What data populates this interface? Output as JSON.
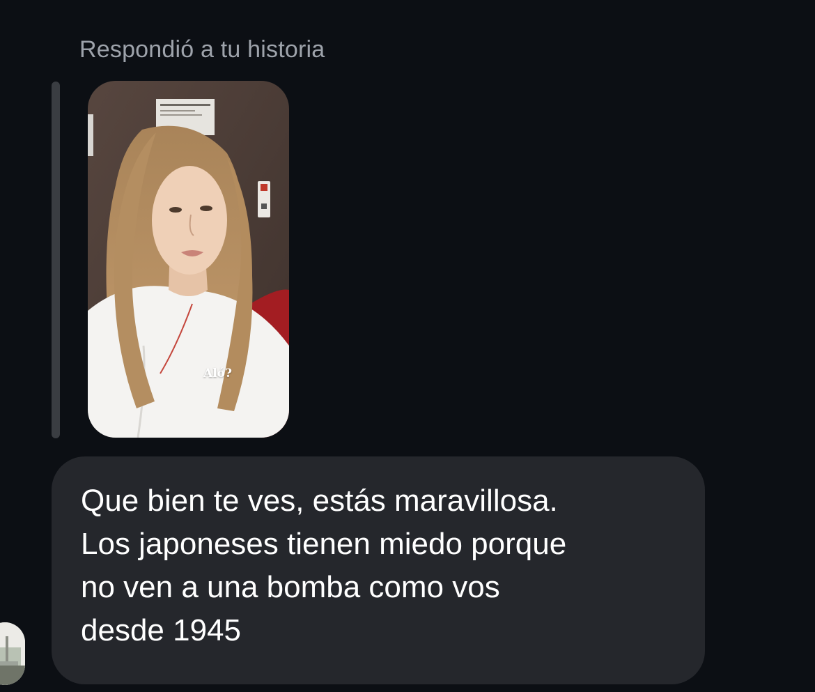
{
  "conversation": {
    "reply_context": "Respondió a tu historia",
    "story": {
      "sticker_text": "Aló?",
      "content": "story-photo"
    },
    "message": {
      "lines": [
        "Que bien te ves, estás maravillosa.",
        "Los japoneses tienen miedo porque",
        "no ven a una bomba como vos",
        "desde 1945"
      ]
    },
    "sender": {
      "avatar": "avatar-photo"
    }
  },
  "colors": {
    "background": "#0c0f14",
    "bubble": "#25272c",
    "quote_bar": "#3a3d42",
    "label_text": "#9ea3ab",
    "message_text": "#ffffff"
  }
}
